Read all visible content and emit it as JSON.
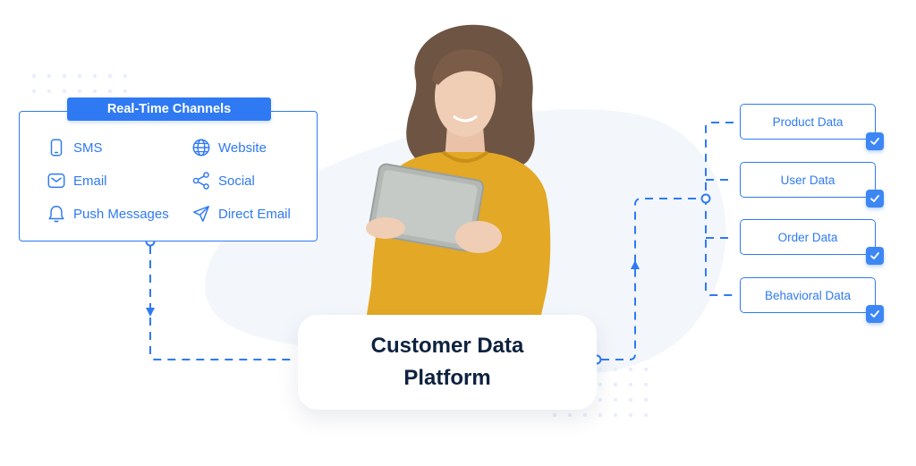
{
  "colors": {
    "accent": "#2f7af3",
    "title_text": "#0e2240",
    "background_blob": "#f3f6fb",
    "sweater": "#e3a825"
  },
  "channels": {
    "title": "Real-Time Channels",
    "items": [
      {
        "label": "SMS",
        "icon": "smartphone-icon"
      },
      {
        "label": "Website",
        "icon": "globe-icon"
      },
      {
        "label": "Email",
        "icon": "envelope-icon"
      },
      {
        "label": "Social",
        "icon": "share-icon"
      },
      {
        "label": "Push Messages",
        "icon": "bell-icon"
      },
      {
        "label": "Direct Email",
        "icon": "send-icon"
      }
    ]
  },
  "center": {
    "title": "Customer Data Platform",
    "illustration": "woman-holding-tablet-photo"
  },
  "outputs": {
    "items": [
      {
        "label": "Product Data",
        "icon": "check-icon"
      },
      {
        "label": "User Data",
        "icon": "check-icon"
      },
      {
        "label": "Order Data",
        "icon": "check-icon"
      },
      {
        "label": "Behavioral Data",
        "icon": "check-icon"
      }
    ]
  }
}
